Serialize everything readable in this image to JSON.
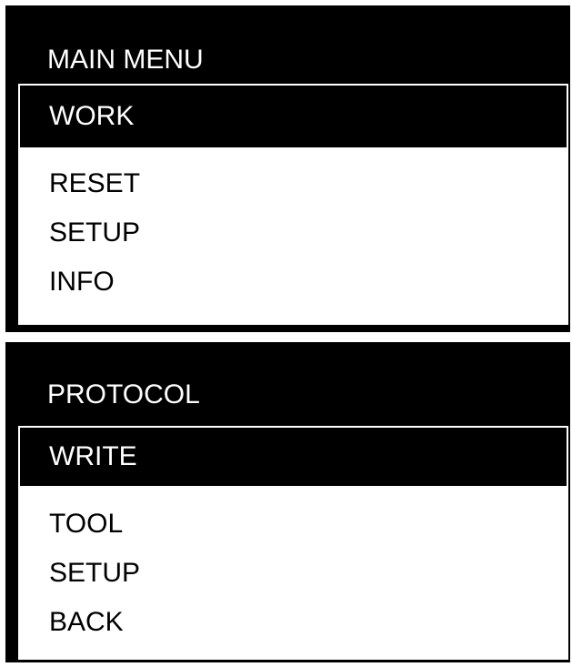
{
  "screens": [
    {
      "title": "MAIN MENU",
      "items": [
        {
          "label": "WORK",
          "selected": true
        },
        {
          "label": "RESET",
          "selected": false
        },
        {
          "label": "SETUP",
          "selected": false
        },
        {
          "label": "INFO",
          "selected": false
        }
      ]
    },
    {
      "title": "PROTOCOL",
      "items": [
        {
          "label": "WRITE",
          "selected": true
        },
        {
          "label": "TOOL",
          "selected": false
        },
        {
          "label": "SETUP",
          "selected": false
        },
        {
          "label": "BACK",
          "selected": false
        }
      ]
    }
  ],
  "colors": {
    "background": "#000000",
    "text_on_dark": "#ffffff",
    "panel": "#ffffff",
    "text_on_light": "#000000"
  }
}
